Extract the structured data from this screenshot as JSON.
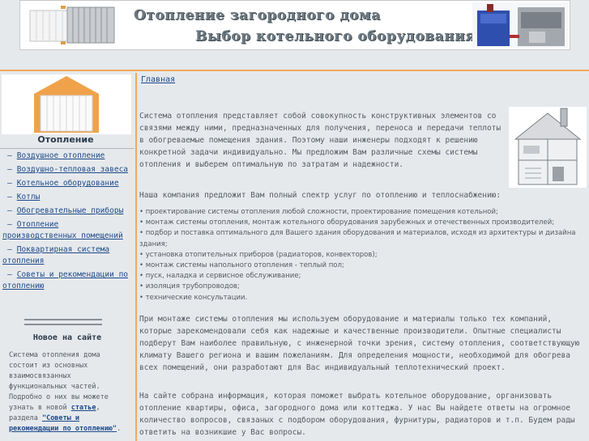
{
  "header": {
    "title_line1": "Отопление загородного дома",
    "title_line2": "Выбор котельного оборудования"
  },
  "sidebar": {
    "title": "Отопление",
    "items": [
      {
        "label": "Воздушное отопление"
      },
      {
        "label": "Воздушно-тепловая завеса"
      },
      {
        "label": "Котельное оборудование"
      },
      {
        "label": "Котлы"
      },
      {
        "label": "Обогревательные приборы"
      },
      {
        "label": "Отопление производственных помещений"
      },
      {
        "label": "Поквартирная система отопления"
      },
      {
        "label": "Советы и рекомендации по отоплению"
      }
    ],
    "news": {
      "title": "Новое на сайте",
      "text_before": "Система отопления дома состоит из основных взаимосвязанных функциональных частей. Подробно о них вы можете узнать в новой ",
      "link1": "статье",
      "text_mid": ", раздела ",
      "link2": "\"Советы и рекомендации по отоплению\"",
      "text_after": "."
    }
  },
  "main": {
    "breadcrumb": "Главная",
    "para1": "Система отопления представляет собой совокупность конструктивных элементов со связями между ними, предназначенных для получения, переноса и передачи теплоты в обогреваемые помещения здания. Поэтому наши инженеры подходят к решению конкретной задачи индивидуально. Мы предложим Вам различные схемы системы отопления и выберем оптимальную по затратам и надежности.",
    "para2": "Наша компания предложит Вам полный спектр услуг по отоплению и теплоснабжению:",
    "services": [
      "проектирование системы отопления любой сложности, проектирование помещения котельной;",
      "монтаж системы отопления, монтаж котельного оборудования зарубежных и отечественных производителей;",
      "подбор и поставка оптимального для Вашего здания оборудования и материалов, исходя из архитектуры и дизайна здания;",
      "установка отопительных приборов (радиаторов, конвекторов);",
      "монтаж системы напольного отопления - теплый пол;",
      "пуск, наладка и сервисное обслуживание;",
      "изоляция трубопроводов;",
      "технические консультации."
    ],
    "para3": "При монтаже системы отопления мы используем оборудование и материалы только тех компаний, которые зарекомендовали себя как надежные и качественные производители. Опытные специалисты подберут Вам наиболее правильную, с инженерной точки зрения, систему отопления, соответствующую климату Вашего региона и вашим пожеланиям. Для определения мощности, необходимой для обогрева всех помещений, они разработают для Вас индивидуальный теплотехнический проект.",
    "para4": "На сайте собрана информация, которая поможет выбрать котельное оборудование, организовать отопление квартиры, офиса, загородного дома или коттеджа. У нас Вы найдете ответы на огромное количество вопросов, связаных с подбором оборудования, фурнитуры, радиаторов и т.п. Будем рады ответить на возникшие у Вас вопросы."
  },
  "colors": {
    "accent": "#f0a95a",
    "link": "#1c4a8a",
    "text": "#555b62",
    "background": "#e6e9ec"
  }
}
